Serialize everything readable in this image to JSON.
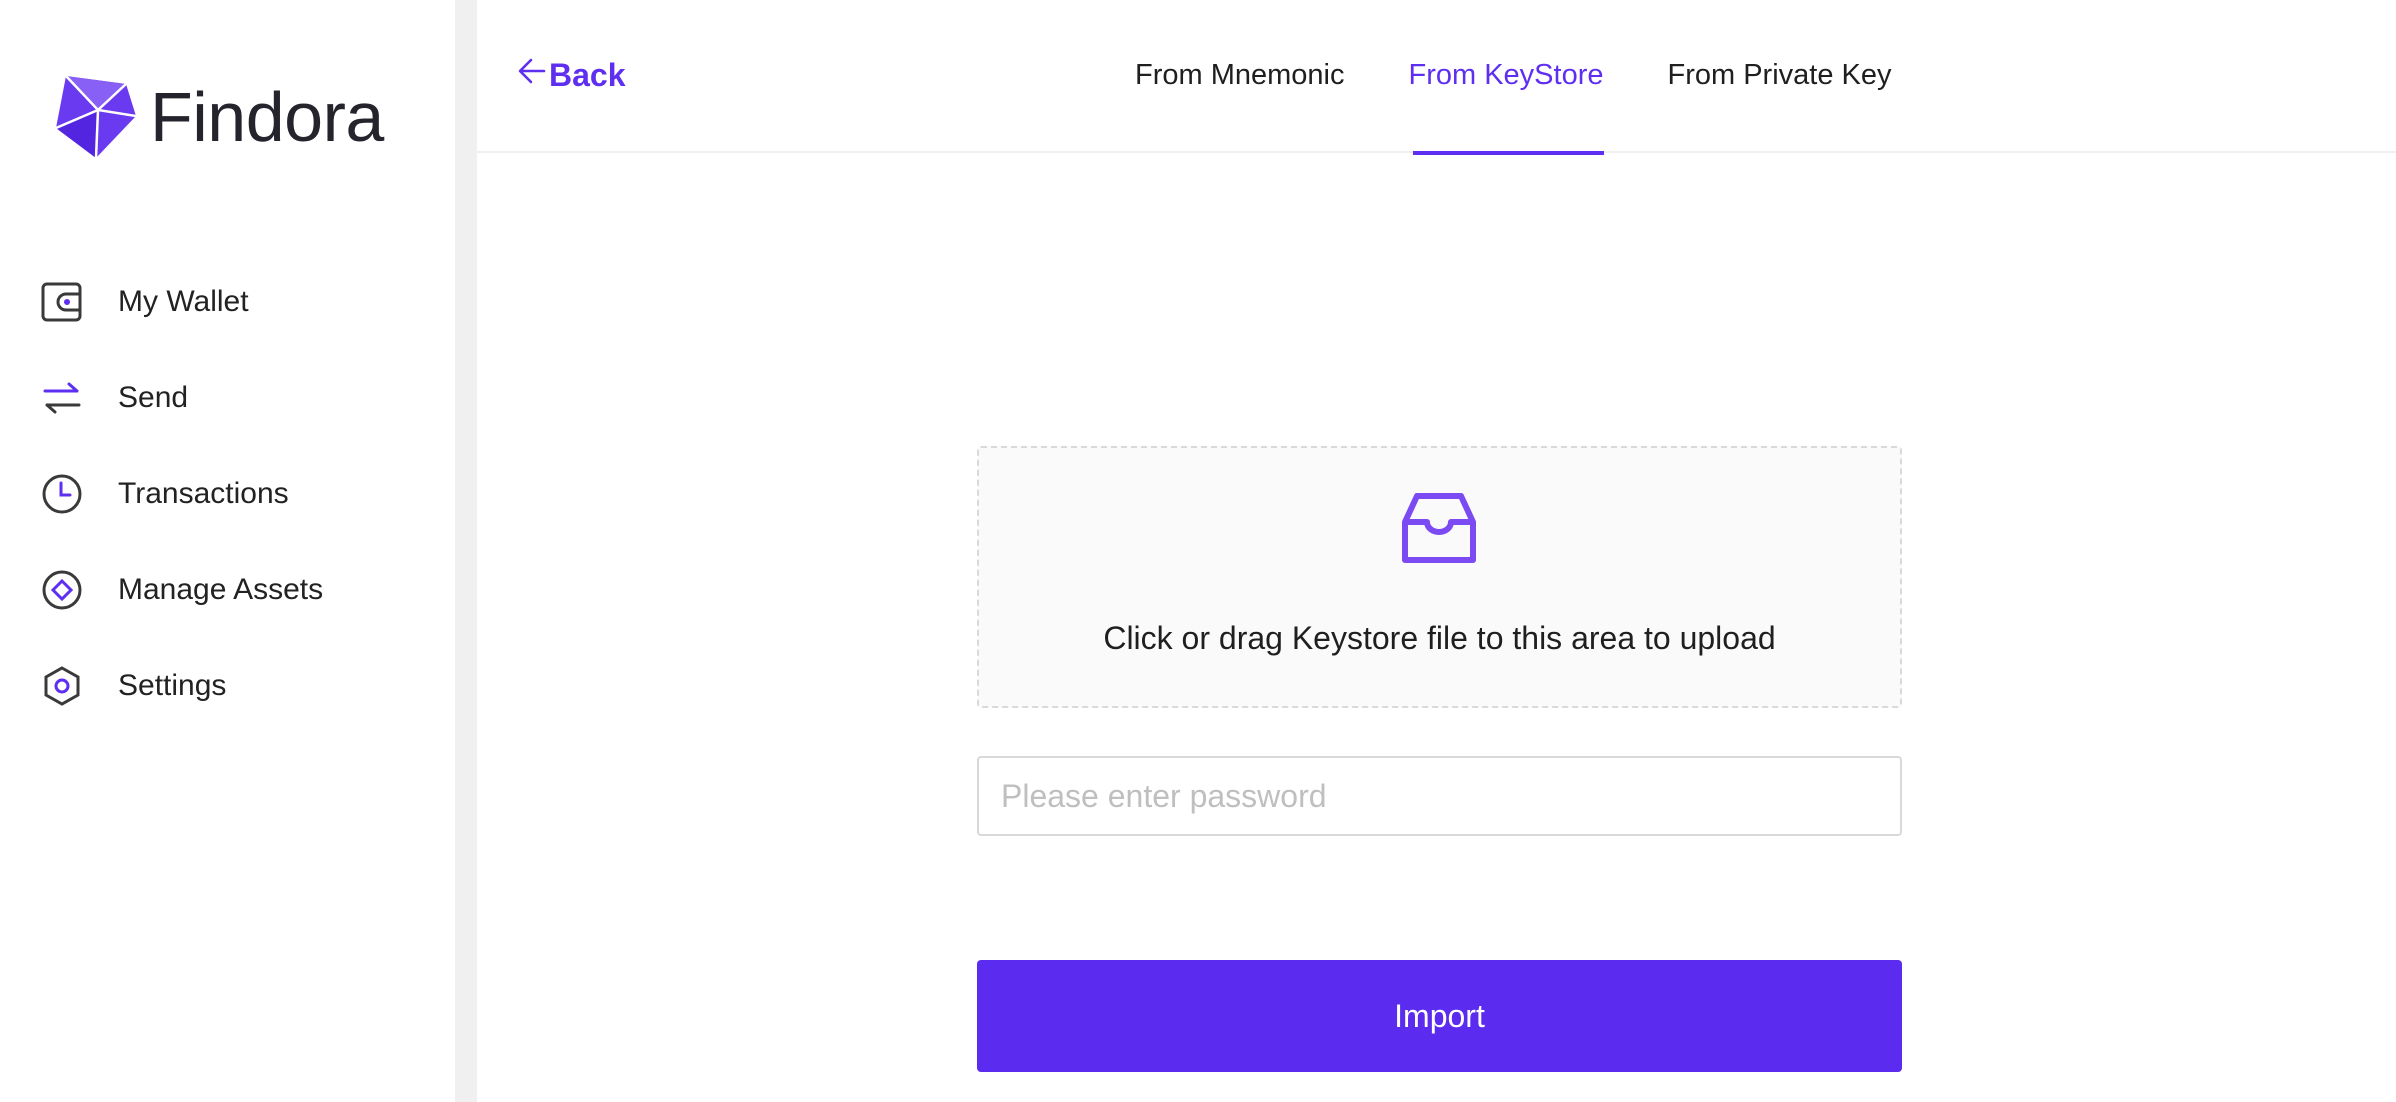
{
  "brand": {
    "name": "Findora",
    "accent_color": "#5f2ff1"
  },
  "sidebar": {
    "items": [
      {
        "label": "My Wallet",
        "icon": "wallet-icon"
      },
      {
        "label": "Send",
        "icon": "transfer-arrows-icon"
      },
      {
        "label": "Transactions",
        "icon": "clock-icon"
      },
      {
        "label": "Manage Assets",
        "icon": "diamond-circle-icon"
      },
      {
        "label": "Settings",
        "icon": "hexagon-settings-icon"
      }
    ]
  },
  "header": {
    "back_label": "Back",
    "tabs": [
      {
        "label": "From Mnemonic",
        "active": false
      },
      {
        "label": "From KeyStore",
        "active": true
      },
      {
        "label": "From Private Key",
        "active": false
      }
    ]
  },
  "upload": {
    "icon": "inbox-icon",
    "text": "Click or drag Keystore file to this area to upload"
  },
  "password": {
    "value": "",
    "placeholder": "Please enter password"
  },
  "import_button": {
    "label": "Import"
  }
}
